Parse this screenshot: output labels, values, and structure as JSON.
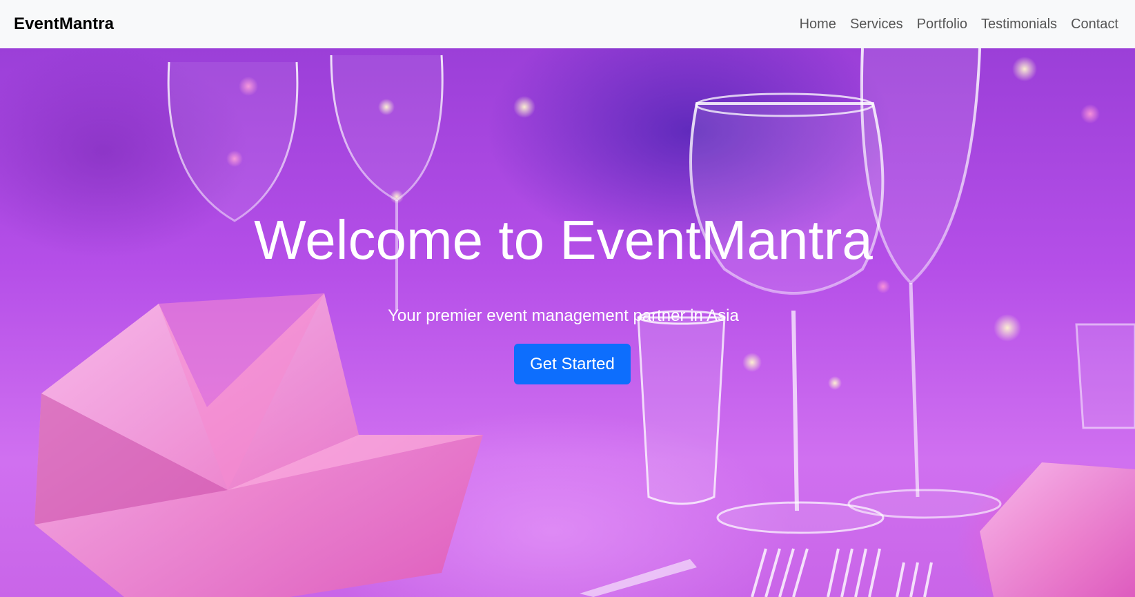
{
  "navbar": {
    "brand": "EventMantra",
    "links": [
      {
        "label": "Home"
      },
      {
        "label": "Services"
      },
      {
        "label": "Portfolio"
      },
      {
        "label": "Testimonials"
      },
      {
        "label": "Contact"
      }
    ]
  },
  "hero": {
    "title": "Welcome to EventMantra",
    "subtitle": "Your premier event management partner in Asia",
    "cta_label": "Get Started",
    "background": "banquet-table-glassware-photo"
  },
  "colors": {
    "navbar_bg": "#f8f9fa",
    "brand_text": "#000000",
    "nav_link": "#555555",
    "hero_text": "#ffffff",
    "cta_bg": "#0d6efd",
    "hero_tint": "#b54fe8"
  }
}
